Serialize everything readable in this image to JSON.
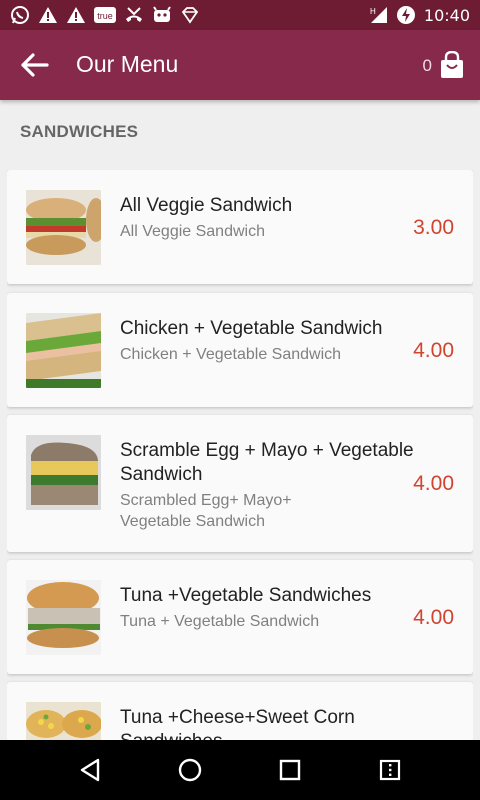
{
  "status_bar": {
    "time": "10:40",
    "icons": [
      "whatsapp-icon",
      "warning-icon",
      "warning-icon",
      "truecaller-icon",
      "missed-call-icon",
      "android-icon",
      "diamond-icon",
      "signal-icon",
      "battery-charging-icon"
    ],
    "true_label": "true",
    "signal_label": "H"
  },
  "app_bar": {
    "title": "Our Menu",
    "cart_count": "0",
    "back_icon": "arrow-left-icon",
    "cart_icon": "shopping-bag-icon"
  },
  "section_title": "SANDWICHES",
  "items": [
    {
      "name": "All Veggie Sandwich",
      "description": "All Veggie Sandwich",
      "price": "3.00"
    },
    {
      "name": "Chicken + Vegetable Sandwich",
      "description": "Chicken + Vegetable Sandwich",
      "price": "4.00"
    },
    {
      "name": "Scramble Egg + Mayo + Vegetable Sandwich",
      "description": "Scrambled Egg+ Mayo+ Vegetable Sandwich",
      "price": "4.00"
    },
    {
      "name": "Tuna +Vegetable Sandwiches",
      "description": "Tuna + Vegetable Sandwich",
      "price": "4.00"
    },
    {
      "name": "Tuna +Cheese+Sweet Corn Sandwiches",
      "description": "",
      "price": ""
    }
  ],
  "nav_bar": {
    "icons": [
      "back-triangle-icon",
      "home-circle-icon",
      "recents-square-icon",
      "menu-icon"
    ]
  },
  "colors": {
    "status_bar": "#6e1c34",
    "app_bar": "#86294a",
    "price": "#d04430",
    "background": "#efefef"
  }
}
